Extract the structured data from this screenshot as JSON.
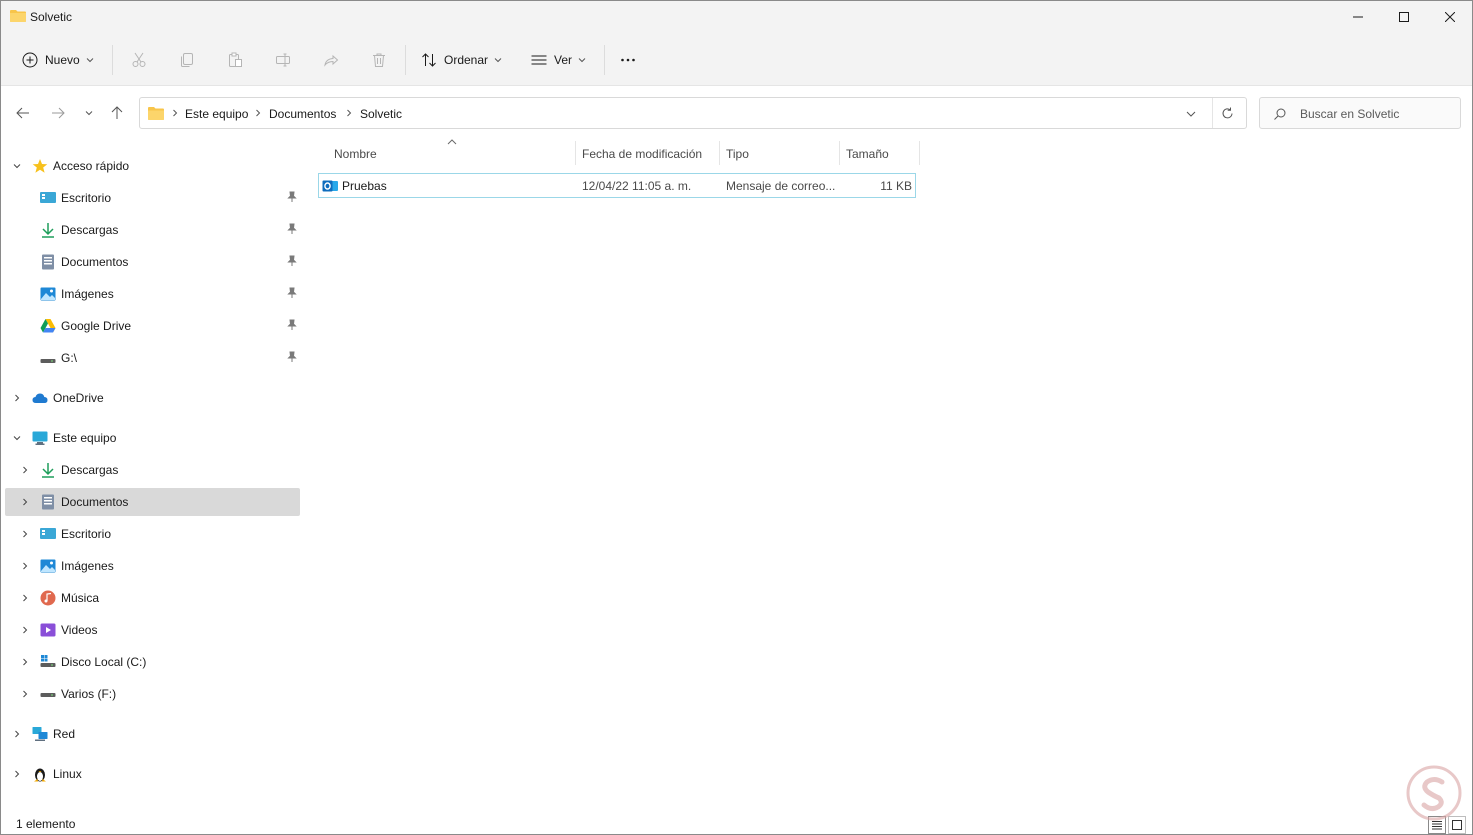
{
  "window": {
    "title": "Solvetic"
  },
  "commandbar": {
    "new_label": "Nuevo",
    "sort_label": "Ordenar",
    "view_label": "Ver",
    "tools": [
      "cut-icon",
      "copy-icon",
      "paste-icon",
      "rename-icon",
      "share-icon",
      "delete-icon"
    ]
  },
  "address": {
    "crumbs": [
      "Este equipo",
      "Documentos",
      "Solvetic"
    ]
  },
  "search": {
    "placeholder": "Buscar en Solvetic"
  },
  "nav": {
    "quick_access": {
      "label": "Acceso rápido",
      "items": [
        "Escritorio",
        "Descargas",
        "Documentos",
        "Imágenes",
        "Google Drive",
        "G:\\"
      ]
    },
    "onedrive": "OneDrive",
    "this_pc": {
      "label": "Este equipo",
      "items": [
        "Descargas",
        "Documentos",
        "Escritorio",
        "Imágenes",
        "Música",
        "Videos",
        "Disco Local (C:)",
        "Varios (F:)"
      ]
    },
    "network": "Red",
    "linux": "Linux"
  },
  "columns": {
    "name": "Nombre",
    "date": "Fecha de modificación",
    "type": "Tipo",
    "size": "Tamaño"
  },
  "files": [
    {
      "name": "Pruebas",
      "date": "12/04/22 11:05 a. m.",
      "type": "Mensaje de correo...",
      "size": "11 KB"
    }
  ],
  "status": {
    "count": "1 elemento"
  },
  "colors": {
    "accent": "#0078d4",
    "folder": "#f8c54a",
    "selection_border": "#9bd7e8",
    "nav_selected": "#d9d9d9"
  }
}
